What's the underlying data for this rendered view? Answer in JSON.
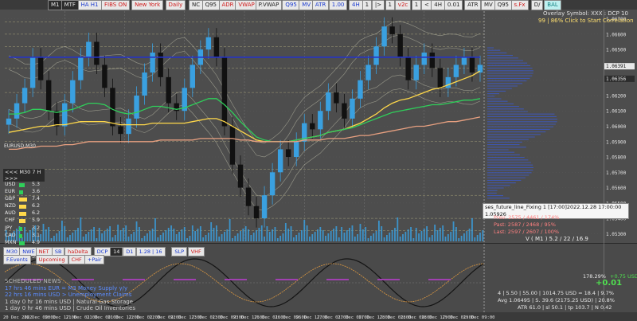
{
  "colors": {
    "background": "#4d4d4d",
    "candle_up": "#3aa0e0",
    "candle_down": "#111111",
    "ema_fast": "#ffd84a",
    "ema_mid": "#2fcf5a",
    "ema_slow": "#e8a080",
    "ma_long": "#2433c8",
    "band": "#d8d8c0",
    "volume": "#3aa0e0",
    "osc_black": "#141414",
    "osc_purple": "#a040b0",
    "osc_orange": "#e09a40"
  },
  "toolbar": {
    "buttons": [
      {
        "label": "M1",
        "style": "dark"
      },
      {
        "label": "MTF",
        "style": "dark"
      },
      {
        "label": "HA H1",
        "style": "blue"
      },
      {
        "label": "FIBS ON",
        "style": "red"
      },
      {
        "label": "New York",
        "style": "red"
      },
      {
        "label": "Daily",
        "style": "red"
      },
      {
        "label": "NC",
        "style": "white"
      },
      {
        "label": "Q95",
        "style": "white"
      },
      {
        "label": "ADR",
        "style": "red"
      },
      {
        "label": "VWAP",
        "style": "red"
      },
      {
        "label": "P.VWAP",
        "style": "white"
      },
      {
        "label": "Q95",
        "style": "blue"
      },
      {
        "label": "MV",
        "style": "blue"
      },
      {
        "label": "ATR",
        "style": "blue"
      },
      {
        "label": "1.00",
        "style": "blue"
      },
      {
        "label": "4H",
        "style": "blue"
      },
      {
        "label": "1",
        "style": "white"
      },
      {
        "label": "|>",
        "style": "white"
      },
      {
        "label": "1",
        "style": "white"
      },
      {
        "label": "v2c",
        "style": "red"
      },
      {
        "label": "1",
        "style": "white"
      },
      {
        "label": "<",
        "style": "white"
      },
      {
        "label": "4H",
        "style": "white"
      },
      {
        "label": "0.01",
        "style": "white"
      },
      {
        "label": "ATR",
        "style": "white"
      },
      {
        "label": "MV",
        "style": "white"
      },
      {
        "label": "Q95",
        "style": "white"
      },
      {
        "label": "s.Fx",
        "style": "red"
      },
      {
        "label": "D/",
        "style": "white"
      },
      {
        "label": "BAL",
        "style": "cyan"
      }
    ],
    "chart_symbol_label": "EURUSD,M30"
  },
  "overlay": {
    "line1": "Overlay Symbol: XXX : DCP 10",
    "line2": "99 | 86% Click to Start Correlation"
  },
  "currency_strength": {
    "header": "<<< M30 7 H >>>",
    "rows": [
      {
        "cur": "USD",
        "val": "5.3",
        "color": "#2fcf5a",
        "level": 0.53
      },
      {
        "cur": "EUR",
        "val": "3.6",
        "color": "#2fcf5a",
        "level": 0.36
      },
      {
        "cur": "GBP",
        "val": "7.4",
        "color": "#ffd84a",
        "level": 0.74
      },
      {
        "cur": "NZD",
        "val": "6.2",
        "color": "#ffd84a",
        "level": 0.62
      },
      {
        "cur": "AUD",
        "val": "6.2",
        "color": "#ffd84a",
        "level": 0.62
      },
      {
        "cur": "CHF",
        "val": "5.9",
        "color": "#ffd84a",
        "level": 0.59
      },
      {
        "cur": "JPY",
        "val": "3.2",
        "color": "#2fcf5a",
        "level": 0.32
      },
      {
        "cur": "CAD",
        "val": "3.1",
        "color": "#2fcf5a",
        "level": 0.31
      },
      {
        "cur": "MXN",
        "val": "4.9",
        "color": "#2fcf5a",
        "level": 0.49
      },
      {
        "cur": "XAU",
        "val": "3.2",
        "color": "#2fcf5a",
        "level": 0.32
      },
      {
        "cur": "XAG",
        "val": "3.0",
        "color": "#2fcf5a",
        "level": 0.3
      }
    ]
  },
  "tooltip": {
    "line1": "ses_future_line_Fixing 1 [17:00]2022.12.28 17:00:00",
    "line2": "1.05926"
  },
  "stats": {
    "prev": "Prev: 2575 / 4461 / 174%",
    "past": "Past: 2587 / 2468 / 95%",
    "last": "Last: 2597 / 2607 / 100%",
    "vm": "V ( M1 ) 5.2 / 22 / 16.9"
  },
  "lower_toolbar": {
    "buttons": [
      {
        "label": "M30",
        "style": "w"
      },
      {
        "label": "NWE",
        "style": "w"
      },
      {
        "label": "NET",
        "style": "r"
      },
      {
        "label": "SB",
        "style": "w"
      },
      {
        "label": "haDelta",
        "style": "r"
      },
      {
        "label": "DCP",
        "style": "w"
      },
      {
        "label": "14",
        "style": "d"
      },
      {
        "label": "D1",
        "style": "w"
      },
      {
        "label": "1.28 | 16",
        "style": "w"
      },
      {
        "label": "SLP",
        "style": "w"
      },
      {
        "label": "VHF",
        "style": "r"
      }
    ],
    "second_row": [
      {
        "label": "F.Events",
        "style": "w"
      },
      {
        "label": "Upcoming",
        "style": "r"
      },
      {
        "label": "CHF",
        "style": "r"
      },
      {
        "label": "+Pair",
        "style": "w"
      }
    ]
  },
  "news": {
    "title": "SCHEDULED NEWS",
    "items": [
      "17 hrs 46 mins  EUR  =  M3 Money Supply y/y",
      "22 hrs 16 mins  USD  >  Unemployment Claims",
      "1 day 0 hr 16 mins  USD  |  Natural Gas Storage",
      "1 day 0 hr 46 mins  USD  |  Crude Oil Inventories"
    ]
  },
  "osc_stats": {
    "pct": "178.29%",
    "chg": "+0.75 USD",
    "big": "+0.01",
    "row1": "4  |  5.50  |  55.00  |  1014.75 USD  =  18.4  |  9.7%",
    "row2": "Avg 1.06495  |  S. 39.6 (2175.25 USD)  |  20.8%",
    "row3": "ATR 61.0  |  sl 50.1  |  tp 103.7  |  N 0.42"
  },
  "right_prices": [
    "1.06700",
    "1.06600",
    "1.06500",
    "1.06400",
    "1.06300",
    "1.06200",
    "1.06100",
    "1.06000",
    "1.05900",
    "1.05800",
    "1.05700",
    "1.05600",
    "1.05500",
    "1.05400",
    "1.05300"
  ],
  "highlight_prices": [
    {
      "label": "1.06391",
      "highlight": true
    },
    {
      "label": "1.06356",
      "highlight": false
    }
  ],
  "time_labels": [
    "20 Dec 2022",
    "20 Dec 09:00",
    "20 Dec 17:00",
    "21 Dec 01:00",
    "21 Dec 09:00",
    "21 Dec 17:00",
    "22 Dec 01:00",
    "22 Dec 09:00",
    "22 Dec 17:00",
    "23 Dec 01:00",
    "23 Dec 09:00",
    "23 Dec 17:00",
    "26 Dec 01:00",
    "26 Dec 09:00",
    "26 Dec 17:00",
    "27 Dec 01:00",
    "27 Dec 09:00",
    "27 Dec 17:00",
    "28 Dec 01:00",
    "28 Dec 09:00",
    "28 Dec 17:00",
    "29 Dec 01:00",
    "29 Dec 09:00"
  ],
  "chart_data": {
    "type": "line",
    "title": "EURUSD,M30",
    "ylim": [
      1.0525,
      1.0675
    ],
    "y_ticks": [
      "1.06700",
      "1.06600",
      "1.06500",
      "1.06400",
      "1.06300",
      "1.06200",
      "1.06100",
      "1.06000",
      "1.05900",
      "1.05800",
      "1.05700",
      "1.05600",
      "1.05500",
      "1.05400",
      "1.05300"
    ],
    "x_ticks": [
      "20 Dec 2022",
      "20 Dec 09:00",
      "20 Dec 17:00",
      "21 Dec 01:00",
      "21 Dec 09:00",
      "21 Dec 17:00",
      "22 Dec 01:00",
      "22 Dec 09:00",
      "22 Dec 17:00",
      "23 Dec 01:00",
      "23 Dec 09:00",
      "23 Dec 17:00",
      "26 Dec 01:00",
      "26 Dec 09:00",
      "26 Dec 17:00",
      "27 Dec 01:00",
      "27 Dec 09:00",
      "27 Dec 17:00",
      "28 Dec 01:00",
      "28 Dec 09:00",
      "28 Dec 17:00",
      "29 Dec 01:00",
      "29 Dec 09:00"
    ],
    "series": [
      {
        "values": [
          1.0605,
          1.0615,
          1.0625,
          1.0645,
          1.063,
          1.061,
          1.06,
          1.0615,
          1.063,
          1.0645,
          1.0655,
          1.064,
          1.0625,
          1.06,
          1.0595,
          1.0605,
          1.062,
          1.0635,
          1.0648,
          1.0632,
          1.0615,
          1.061,
          1.0625,
          1.064,
          1.065,
          1.0658,
          1.0645,
          1.06,
          1.0575,
          1.056,
          1.0548,
          1.054,
          1.0555,
          1.057,
          1.0585,
          1.058,
          1.059,
          1.0602,
          1.0598,
          1.061,
          1.0622,
          1.0615,
          1.0605,
          1.0618,
          1.063,
          1.064,
          1.0652,
          1.0665,
          1.066,
          1.0645,
          1.063,
          1.064,
          1.0648,
          1.0638,
          1.0625,
          1.0632,
          1.064,
          1.0645,
          1.0635,
          1.064
        ]
      },
      {
        "values": [
          1.0596,
          1.0597,
          1.0598,
          1.0599,
          1.06,
          1.06,
          1.0601,
          1.0601,
          1.0602,
          1.0603,
          1.0603,
          1.0603,
          1.0603,
          1.0602,
          1.0601,
          1.0601,
          1.0601,
          1.0601,
          1.0602,
          1.0602,
          1.0602,
          1.0602,
          1.0602,
          1.0603,
          1.0604,
          1.0605,
          1.0605,
          1.0603,
          1.06,
          1.0597,
          1.0594,
          1.0591,
          1.059,
          1.059,
          1.059,
          1.059,
          1.0591,
          1.0592,
          1.0593,
          1.0594,
          1.0596,
          1.0597,
          1.0598,
          1.06,
          1.0602,
          1.0605,
          1.0608,
          1.0612,
          1.0615,
          1.0617,
          1.0618,
          1.062,
          1.0622,
          1.0624,
          1.0625,
          1.0627,
          1.0629,
          1.0631,
          1.0633,
          1.0636
        ]
      },
      {
        "values": [
          1.0608,
          1.0608,
          1.0609,
          1.0611,
          1.0611,
          1.061,
          1.0609,
          1.061,
          1.0611,
          1.0613,
          1.0615,
          1.0615,
          1.0614,
          1.0611,
          1.0609,
          1.0608,
          1.0609,
          1.0611,
          1.0613,
          1.0613,
          1.0612,
          1.0611,
          1.0612,
          1.0614,
          1.0616,
          1.0618,
          1.0618,
          1.0614,
          1.0609,
          1.0603,
          1.0598,
          1.0593,
          1.0591,
          1.059,
          1.059,
          1.059,
          1.0591,
          1.0592,
          1.0593,
          1.0594,
          1.0596,
          1.0597,
          1.0598,
          1.0599,
          1.0601,
          1.0603,
          1.0605,
          1.0607,
          1.0609,
          1.061,
          1.0611,
          1.0612,
          1.0613,
          1.0614,
          1.0614,
          1.0615,
          1.0616,
          1.0617,
          1.0617,
          1.0618
        ]
      },
      {
        "values": [
          1.0585,
          1.0585,
          1.0586,
          1.0586,
          1.0587,
          1.0587,
          1.0587,
          1.0588,
          1.0588,
          1.0589,
          1.059,
          1.059,
          1.059,
          1.059,
          1.059,
          1.059,
          1.059,
          1.059,
          1.059,
          1.0591,
          1.0591,
          1.0591,
          1.0591,
          1.0591,
          1.0592,
          1.0592,
          1.0592,
          1.0592,
          1.0592,
          1.0591,
          1.0591,
          1.059,
          1.059,
          1.059,
          1.059,
          1.059,
          1.059,
          1.0591,
          1.0591,
          1.0591,
          1.0592,
          1.0592,
          1.0592,
          1.0593,
          1.0594,
          1.0594,
          1.0595,
          1.0596,
          1.0597,
          1.0598,
          1.0599,
          1.06,
          1.06,
          1.0601,
          1.0602,
          1.0603,
          1.0603,
          1.0604,
          1.0605,
          1.0606
        ]
      },
      {
        "values": [
          1.0645,
          1.0645,
          1.0645,
          1.0645,
          1.0645,
          1.0645,
          1.0645,
          1.0645,
          1.0645,
          1.0645,
          1.0645,
          1.0645,
          1.0645,
          1.0645,
          1.0645,
          1.0645,
          1.0645,
          1.0645,
          1.0645,
          1.0645,
          1.0645,
          1.0645,
          1.0645,
          1.0645,
          1.0645,
          1.0645,
          1.0645,
          1.0645,
          1.0645,
          1.0645,
          1.0645,
          1.0645,
          1.0645,
          1.0645,
          1.0645,
          1.0645,
          1.0645,
          1.0645,
          1.0645,
          1.0645,
          1.0645,
          1.0645,
          1.0645,
          1.0645,
          1.0645,
          1.0645,
          1.0645,
          1.0645,
          1.0645,
          1.0645,
          1.0645,
          1.0645,
          1.0645,
          1.0645,
          1.0645,
          1.0645,
          1.0645,
          1.0645,
          1.0645,
          1.0645
        ]
      }
    ]
  }
}
